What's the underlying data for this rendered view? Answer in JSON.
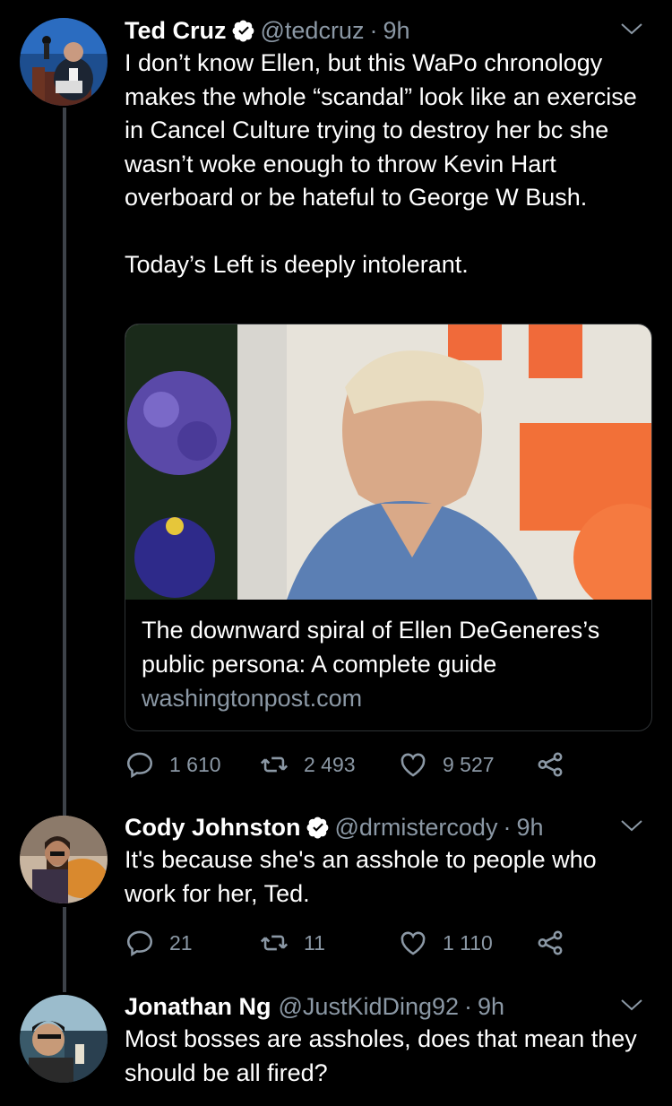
{
  "thread": [
    {
      "name": "Ted Cruz",
      "handle": "@tedcruz",
      "sep": "·",
      "time": "9h",
      "text": "I don’t know Ellen, but this WaPo chronology makes the whole “scandal” look like an exercise in Cancel Culture trying to destroy her bc she wasn’t woke enough to throw Kevin Hart overboard or be hateful to George W Bush.\n\nToday’s Left is deeply intolerant.",
      "card": {
        "title": "The downward spiral of Ellen DeGeneres’s public persona: A complete guide",
        "domain": "washingtonpost.com"
      },
      "stats": {
        "replies": "1 610",
        "retweets": "2 493",
        "likes": "9 527"
      }
    },
    {
      "name": "Cody Johnston",
      "handle": "@drmistercody",
      "sep": "·",
      "time": "9h",
      "text": "It's because she's an asshole to people who work for her, Ted.",
      "stats": {
        "replies": "21",
        "retweets": "11",
        "likes": "1 110"
      }
    },
    {
      "name": "Jonathan Ng",
      "handle": "@JustKidDing92",
      "sep": "·",
      "time": "9h",
      "text": "Most bosses are assholes, does that mean they should be all fired?"
    }
  ],
  "colors": {
    "background": "#000000",
    "secondary_text": "#8b98a5",
    "verified": "#ffffff",
    "thread_line": "#3d4249"
  },
  "icons": [
    "verified-icon",
    "chevron-down-icon",
    "reply-icon",
    "retweet-icon",
    "like-icon",
    "share-icon"
  ]
}
